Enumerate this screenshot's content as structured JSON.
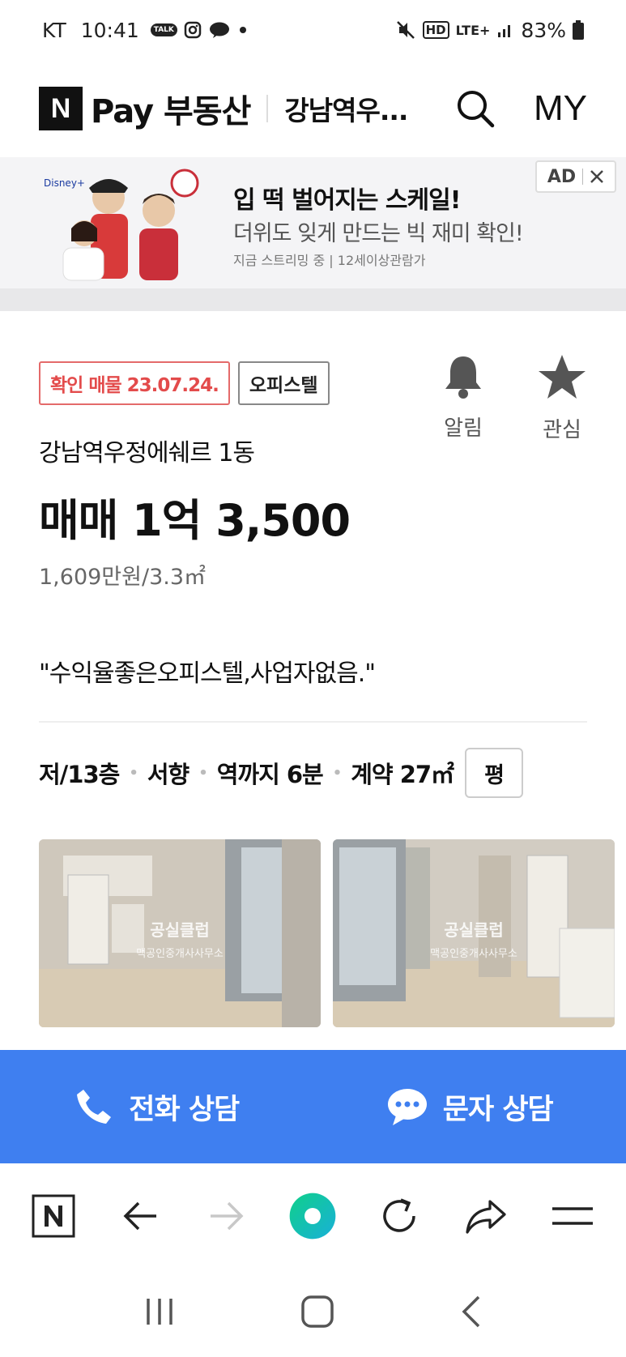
{
  "status_bar": {
    "carrier": "KT",
    "time": "10:41",
    "talk_badge": "TALK",
    "hd_badge": "HD",
    "network": "LTE+",
    "battery": "83%"
  },
  "header": {
    "logo_letter": "N",
    "brand": "Pay 부동산",
    "title": "강남역우...",
    "my_label": "MY"
  },
  "ad": {
    "headline": "입 떡 벌어지는 스케일!",
    "subline": "더위도 잊게 만드는 빅 재미 확인!",
    "small_text": "지금 스트리밍 중 | 12세이상관람가",
    "badge": "AD"
  },
  "listing": {
    "confirmed_tag": "확인 매물 23.07.24.",
    "type_tag": "오피스텔",
    "alert_label": "알림",
    "favorite_label": "관심",
    "building_name": "강남역우정에쉐르 1동",
    "price": "매매 1억 3,500",
    "unit_price": "1,609만원/3.3㎡",
    "description": "\"수익율좋은오피스텔,사업자없음.\"",
    "specs": {
      "floor": "저/13층",
      "direction": "서향",
      "station": "역까지 6분",
      "area": "계약 27㎡",
      "unit_toggle": "평"
    },
    "photo_watermark": "공실클럽",
    "photo_caption": "맥공인중개사사무소"
  },
  "contact": {
    "call_label": "전화 상담",
    "sms_label": "문자 상담"
  },
  "colors": {
    "accent": "#3f7ff0",
    "confirm_red": "#e34b4b",
    "green_button": "#1ec981"
  }
}
